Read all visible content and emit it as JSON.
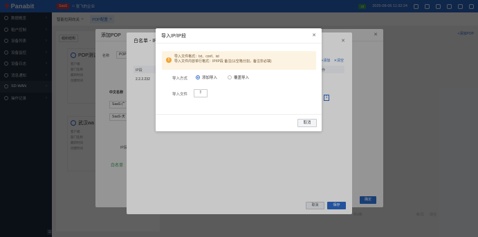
{
  "topbar": {
    "logo": "Panabit",
    "badge": "SaaS",
    "tenant": "张飞的企业",
    "status_pill": "19",
    "datetime": "2025-08-05 11:32:24"
  },
  "sidebar": {
    "items": [
      {
        "label": "数据概览"
      },
      {
        "label": "租户控制"
      },
      {
        "label": "设备列表"
      },
      {
        "label": "设备监控"
      },
      {
        "label": "设备日志"
      },
      {
        "label": "消息通知"
      },
      {
        "label": "SD-WAN"
      },
      {
        "label": "操作记录"
      }
    ]
  },
  "tabs": [
    {
      "label": "智能拉网向关"
    },
    {
      "label": "POP配置"
    }
  ],
  "background": {
    "org_tab": "组织结构",
    "pop_card_1_title": "POP测试",
    "pop_card_2_title": "武汉wa",
    "rows_1": [
      "客户端",
      "部门名称",
      "最新时间",
      "创建时间"
    ],
    "rows_2": [
      "客户端",
      "部门名称",
      "最新时间",
      "创建时间"
    ],
    "right_link": "+添加POP"
  },
  "addpop": {
    "title": "添加POP",
    "name_label": "名称",
    "name_value": "POP",
    "section": "中文名称",
    "field1": "SaaS-广",
    "field2": "SaaS-天",
    "ip_label": "IP段",
    "whitelist_label": "白名单",
    "confirm": "确定"
  },
  "whitelist": {
    "title": "白名单 - IP",
    "col_ip": "IP段",
    "col_op": "操作",
    "cell_ip": "2.2.2.232",
    "add_link": "+添加",
    "clear_link": "清空",
    "page": "1",
    "cancel": "取消",
    "save": "保存"
  },
  "import": {
    "title": "导入IP/IP段",
    "notice_line1": "导入文件格式：txt、conf、ist",
    "notice_line2": "导入文件内容单行格式：IP/IP段 备注(以空格分割，备注非必填)",
    "mode_label": "导入方式",
    "option_add": "添加导入",
    "option_overwrite": "覆盖导入",
    "file_label": "导入文件",
    "upload_symbol": "⤒",
    "cancel": "取消"
  },
  "pager": {
    "total": "共3条",
    "page_size": "条/页",
    "goto": "前往"
  }
}
